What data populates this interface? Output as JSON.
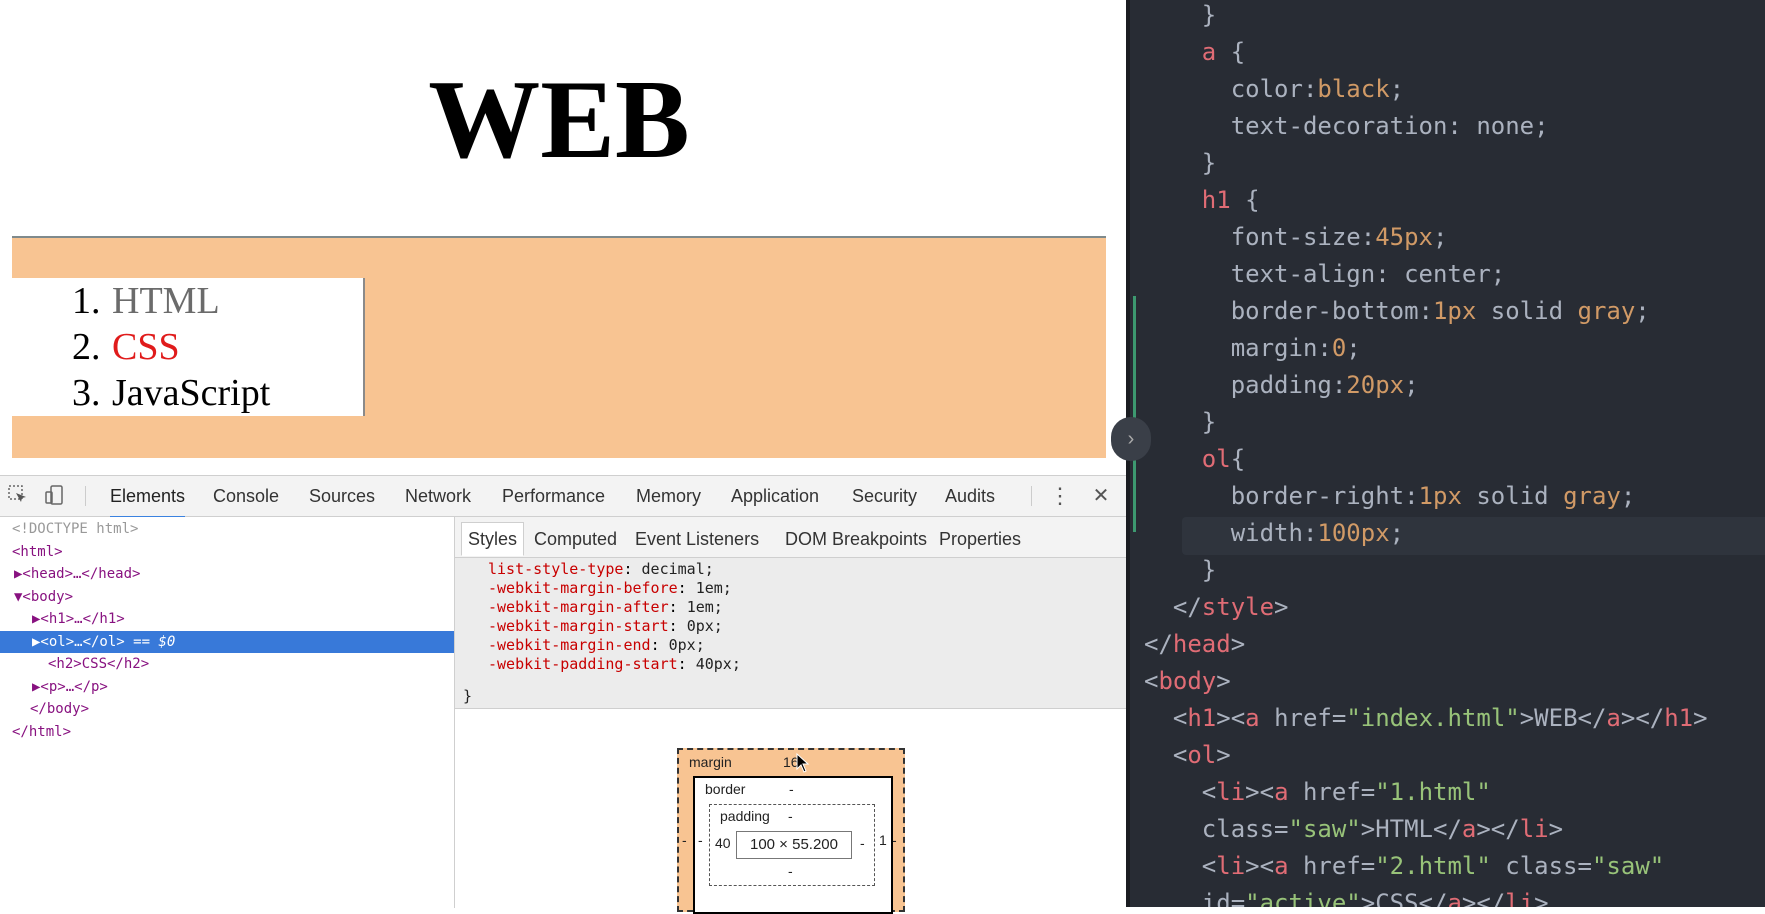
{
  "page": {
    "heading": "WEB",
    "list": [
      {
        "number": "1.",
        "label": "HTML",
        "color": "#6b6b6b"
      },
      {
        "number": "2.",
        "label": "CSS",
        "color": "#e01b1b"
      },
      {
        "number": "3.",
        "label": "JavaScript",
        "color": "#000000"
      }
    ],
    "band_color": "#f8c492"
  },
  "devtools": {
    "tabs": [
      "Elements",
      "Console",
      "Sources",
      "Network",
      "Performance",
      "Memory",
      "Application",
      "Security",
      "Audits"
    ],
    "active_tab": "Elements",
    "more_icon": "⋮",
    "close_icon": "✕",
    "dom": [
      {
        "text": "<!DOCTYPE html>",
        "kind": "comment"
      },
      {
        "text": "<html>"
      },
      {
        "text": "▶<head>…</head>"
      },
      {
        "text": "▼<body>"
      },
      {
        "text": "▶<h1>…</h1>"
      },
      {
        "text": "▶<ol>…</ol>",
        "suffix": " == $0",
        "selected": true
      },
      {
        "text": "<h2>CSS</h2>"
      },
      {
        "text": "▶<p>…</p>"
      },
      {
        "text": "</body>"
      },
      {
        "text": "</html>"
      }
    ],
    "styles_tabs": [
      "Styles",
      "Computed",
      "Event Listeners",
      "DOM Breakpoints",
      "Properties"
    ],
    "active_styles_tab": "Styles",
    "declarations": [
      {
        "prop": "list-style-type",
        "val": "decimal;"
      },
      {
        "prop": "-webkit-margin-before",
        "val": "1em;"
      },
      {
        "prop": "-webkit-margin-after",
        "val": "1em;"
      },
      {
        "prop": "-webkit-margin-start",
        "val": "0px;"
      },
      {
        "prop": "-webkit-margin-end",
        "val": "0px;"
      },
      {
        "prop": "-webkit-padding-start",
        "val": "40px;"
      }
    ],
    "rule_close": "}",
    "box_model": {
      "margin_label": "margin",
      "margin_top": "16",
      "margin_left": "-",
      "margin_right": "-",
      "border_label": "border",
      "border_top": "-",
      "border_left": "-",
      "border_right": "1",
      "padding_label": "padding",
      "padding_top": "-",
      "padding_left": "40",
      "padding_right": "-",
      "padding_bottom": "-",
      "content": "100 × 55.200"
    }
  },
  "editor": {
    "lines": [
      [
        {
          "t": "    }",
          "c": "#abb2bf"
        }
      ],
      [
        {
          "t": "    ",
          "c": "#abb2bf"
        },
        {
          "t": "a",
          "c": "#e06c75"
        },
        {
          "t": " {",
          "c": "#abb2bf"
        }
      ],
      [
        {
          "t": "      color:",
          "c": "#abb2bf"
        },
        {
          "t": "black",
          "c": "#d19a66"
        },
        {
          "t": ";",
          "c": "#abb2bf"
        }
      ],
      [
        {
          "t": "      text-decoration: none;",
          "c": "#abb2bf"
        }
      ],
      [
        {
          "t": "    }",
          "c": "#abb2bf"
        }
      ],
      [
        {
          "t": "    ",
          "c": "#abb2bf"
        },
        {
          "t": "h1",
          "c": "#e06c75"
        },
        {
          "t": " {",
          "c": "#abb2bf"
        }
      ],
      [
        {
          "t": "      font-size:",
          "c": "#abb2bf"
        },
        {
          "t": "45px",
          "c": "#d19a66"
        },
        {
          "t": ";",
          "c": "#abb2bf"
        }
      ],
      [
        {
          "t": "      text-align: center;",
          "c": "#abb2bf"
        }
      ],
      [
        {
          "t": "      border-bottom:",
          "c": "#abb2bf"
        },
        {
          "t": "1px",
          "c": "#d19a66"
        },
        {
          "t": " solid ",
          "c": "#abb2bf"
        },
        {
          "t": "gray",
          "c": "#d19a66"
        },
        {
          "t": ";",
          "c": "#abb2bf"
        }
      ],
      [
        {
          "t": "      margin:",
          "c": "#abb2bf"
        },
        {
          "t": "0",
          "c": "#d19a66"
        },
        {
          "t": ";",
          "c": "#abb2bf"
        }
      ],
      [
        {
          "t": "      padding:",
          "c": "#abb2bf"
        },
        {
          "t": "20px",
          "c": "#d19a66"
        },
        {
          "t": ";",
          "c": "#abb2bf"
        }
      ],
      [
        {
          "t": "    }",
          "c": "#abb2bf"
        }
      ],
      [
        {
          "t": "    ",
          "c": "#abb2bf"
        },
        {
          "t": "ol",
          "c": "#e06c75"
        },
        {
          "t": "{",
          "c": "#abb2bf"
        }
      ],
      [
        {
          "t": "      border-right:",
          "c": "#abb2bf"
        },
        {
          "t": "1px",
          "c": "#d19a66"
        },
        {
          "t": " solid ",
          "c": "#abb2bf"
        },
        {
          "t": "gray",
          "c": "#d19a66"
        },
        {
          "t": ";",
          "c": "#abb2bf"
        }
      ],
      [
        {
          "t": "      width:",
          "c": "#abb2bf"
        },
        {
          "t": "100px",
          "c": "#d19a66"
        },
        {
          "t": ";",
          "c": "#abb2bf"
        }
      ],
      [
        {
          "t": "    }",
          "c": "#abb2bf"
        }
      ],
      [
        {
          "t": "  </",
          "c": "#abb2bf"
        },
        {
          "t": "style",
          "c": "#e06c75"
        },
        {
          "t": ">",
          "c": "#abb2bf"
        }
      ],
      [
        {
          "t": "</",
          "c": "#abb2bf"
        },
        {
          "t": "head",
          "c": "#e06c75"
        },
        {
          "t": ">",
          "c": "#abb2bf"
        }
      ],
      [
        {
          "t": "<",
          "c": "#abb2bf"
        },
        {
          "t": "body",
          "c": "#e06c75"
        },
        {
          "t": ">",
          "c": "#abb2bf"
        }
      ],
      [
        {
          "t": "  <",
          "c": "#abb2bf"
        },
        {
          "t": "h1",
          "c": "#e06c75"
        },
        {
          "t": "><",
          "c": "#abb2bf"
        },
        {
          "t": "a",
          "c": "#e06c75"
        },
        {
          "t": " href=",
          "c": "#abb2bf"
        },
        {
          "t": "\"index.html\"",
          "c": "#98c379"
        },
        {
          "t": ">WEB</",
          "c": "#abb2bf"
        },
        {
          "t": "a",
          "c": "#e06c75"
        },
        {
          "t": "></",
          "c": "#abb2bf"
        },
        {
          "t": "h1",
          "c": "#e06c75"
        },
        {
          "t": ">",
          "c": "#abb2bf"
        }
      ],
      [
        {
          "t": "  <",
          "c": "#abb2bf"
        },
        {
          "t": "ol",
          "c": "#e06c75"
        },
        {
          "t": ">",
          "c": "#abb2bf"
        }
      ],
      [
        {
          "t": "    <",
          "c": "#abb2bf"
        },
        {
          "t": "li",
          "c": "#e06c75"
        },
        {
          "t": "><",
          "c": "#abb2bf"
        },
        {
          "t": "a",
          "c": "#e06c75"
        },
        {
          "t": " href=",
          "c": "#abb2bf"
        },
        {
          "t": "\"1.html\"",
          "c": "#98c379"
        }
      ],
      [
        {
          "t": "    class=",
          "c": "#abb2bf"
        },
        {
          "t": "\"saw\"",
          "c": "#98c379"
        },
        {
          "t": ">HTML</",
          "c": "#abb2bf"
        },
        {
          "t": "a",
          "c": "#e06c75"
        },
        {
          "t": "></",
          "c": "#abb2bf"
        },
        {
          "t": "li",
          "c": "#e06c75"
        },
        {
          "t": ">",
          "c": "#abb2bf"
        }
      ],
      [
        {
          "t": "    <",
          "c": "#abb2bf"
        },
        {
          "t": "li",
          "c": "#e06c75"
        },
        {
          "t": "><",
          "c": "#abb2bf"
        },
        {
          "t": "a",
          "c": "#e06c75"
        },
        {
          "t": " href=",
          "c": "#abb2bf"
        },
        {
          "t": "\"2.html\"",
          "c": "#98c379"
        },
        {
          "t": " class=",
          "c": "#abb2bf"
        },
        {
          "t": "\"saw\"",
          "c": "#98c379"
        }
      ],
      [
        {
          "t": "    id=",
          "c": "#abb2bf"
        },
        {
          "t": "\"active\"",
          "c": "#98c379"
        },
        {
          "t": ">CSS</",
          "c": "#abb2bf"
        },
        {
          "t": "a",
          "c": "#e06c75"
        },
        {
          "t": "></",
          "c": "#abb2bf"
        },
        {
          "t": "li",
          "c": "#e06c75"
        },
        {
          "t": ">",
          "c": "#abb2bf"
        }
      ]
    ]
  }
}
